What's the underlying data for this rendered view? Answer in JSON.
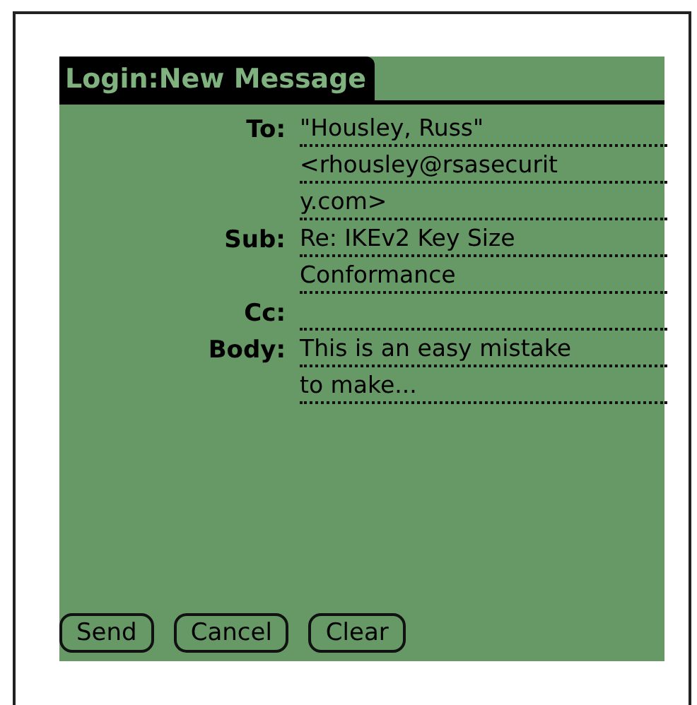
{
  "window": {
    "title": "Login:New Message"
  },
  "fields": [
    {
      "label": "To:",
      "lines": [
        "\"Housley, Russ\"",
        "<rhousley@rsasecurit",
        "y.com>"
      ]
    },
    {
      "label": "Sub:",
      "lines": [
        "Re: IKEv2 Key Size",
        "Conformance"
      ]
    },
    {
      "label": "Cc:"
    },
    {
      "label": "Body:",
      "lines": [
        "This is an easy mistake",
        "to make..."
      ]
    }
  ],
  "buttons": [
    "Send",
    "Cancel",
    "Clear"
  ]
}
